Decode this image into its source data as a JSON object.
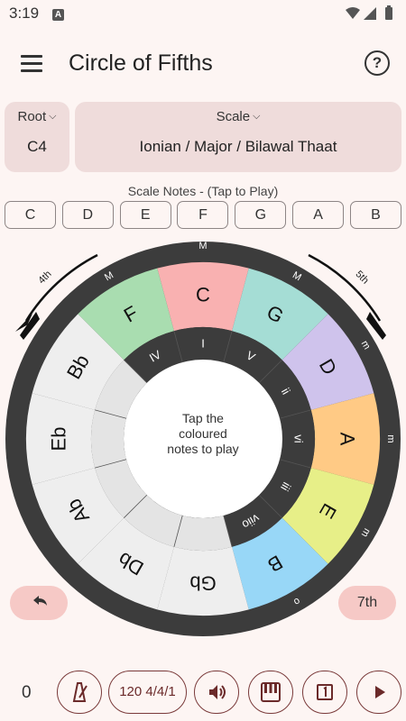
{
  "status_bar": {
    "time": "3:19",
    "notification_icon": "A"
  },
  "app_bar": {
    "title": "Circle of Fifths",
    "help_glyph": "?"
  },
  "root": {
    "label": "Root",
    "value": "C4"
  },
  "scale": {
    "label": "Scale",
    "value": "Ionian / Major / Bilawal Thaat"
  },
  "scale_notes": {
    "title": "Scale Notes - (Tap to Play)",
    "notes": [
      "C",
      "D",
      "E",
      "F",
      "G",
      "A",
      "B"
    ]
  },
  "circle": {
    "arrow_left_label": "4th",
    "arrow_right_label": "5th",
    "center_text": [
      "Tap the",
      "coloured",
      "notes to play"
    ],
    "segments": [
      {
        "note": "C",
        "numeral": "I",
        "quality": "M",
        "color": "#f9b1b1"
      },
      {
        "note": "G",
        "numeral": "V",
        "quality": "M",
        "color": "#a5ddd5"
      },
      {
        "note": "D",
        "numeral": "ii",
        "quality": "m",
        "color": "#cfc3ec"
      },
      {
        "note": "A",
        "numeral": "vi",
        "quality": "m",
        "color": "#ffca85"
      },
      {
        "note": "E",
        "numeral": "iii",
        "quality": "m",
        "color": "#e7ef88"
      },
      {
        "note": "B",
        "numeral": "viio",
        "quality": "o",
        "color": "#98d7f7"
      },
      {
        "note": "Gb",
        "numeral": "",
        "quality": "",
        "color": "#eeeeee"
      },
      {
        "note": "Db",
        "numeral": "",
        "quality": "",
        "color": "#eeeeee"
      },
      {
        "note": "Ab",
        "numeral": "",
        "quality": "",
        "color": "#eeeeee"
      },
      {
        "note": "Eb",
        "numeral": "",
        "quality": "",
        "color": "#eeeeee"
      },
      {
        "note": "Bb",
        "numeral": "",
        "quality": "",
        "color": "#eeeeee"
      },
      {
        "note": "F",
        "numeral": "IV",
        "quality": "M",
        "color": "#a9ddb0"
      }
    ],
    "ring_color": "#3c3c3c",
    "inactive_inner_color": "#e4e4e4"
  },
  "controls": {
    "undo_icon": "undo-icon",
    "seventh_label": "7th"
  },
  "bottom_bar": {
    "count": "0",
    "tempo_label": "120 4/4/1",
    "buttons": [
      "metronome-icon",
      "volume-icon",
      "piano-icon",
      "one-box-icon",
      "play-icon"
    ]
  },
  "colors": {
    "accent": "#6b2a2a",
    "pill_bg": "#f6c9c6",
    "card_bg": "#efdcdb",
    "page_bg": "#fdf5f3"
  }
}
